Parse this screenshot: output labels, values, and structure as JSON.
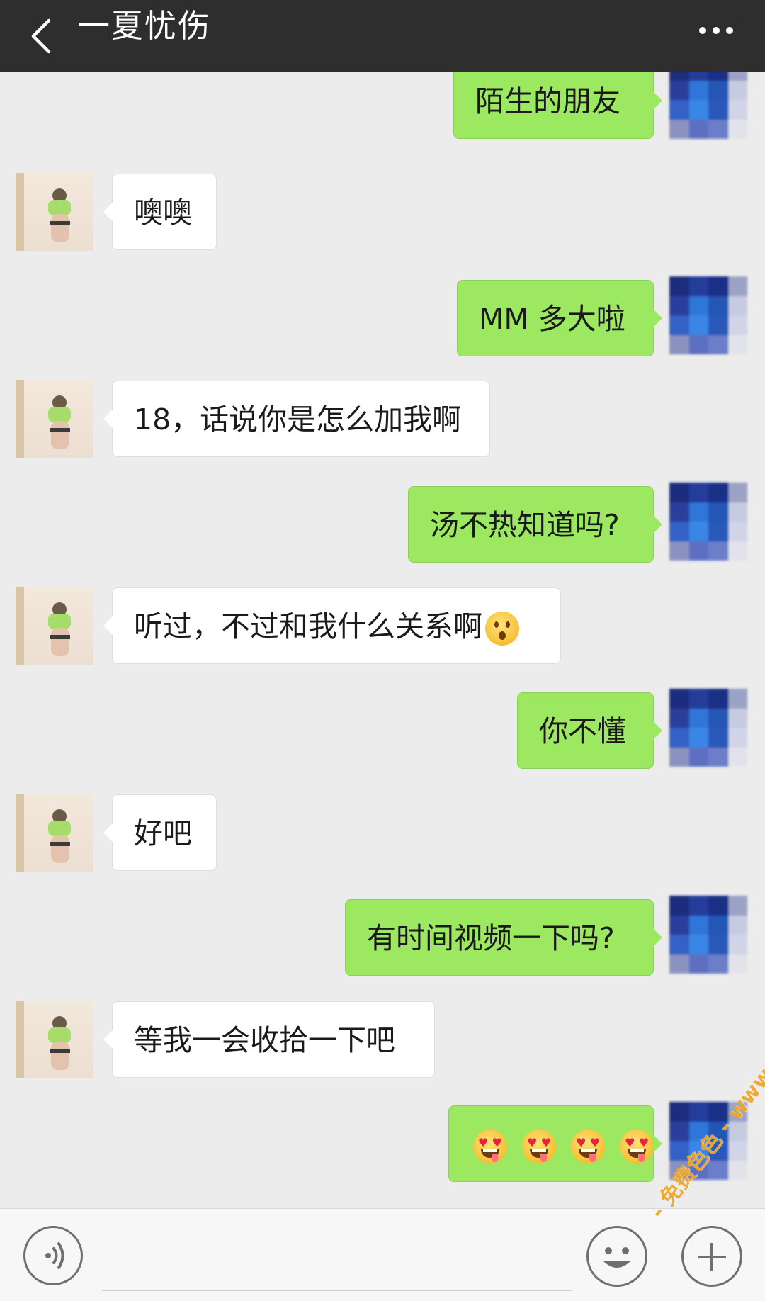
{
  "header": {
    "title": "一夏忧伤",
    "back_icon": "chevron-left-icon",
    "more_icon": "more-dots-icon",
    "background": "#2e2e2e"
  },
  "messages": [
    {
      "side": "right",
      "text": "陌生的朋友"
    },
    {
      "side": "left",
      "text": "噢噢"
    },
    {
      "side": "right",
      "text": "MM 多大啦"
    },
    {
      "side": "left",
      "text": "18，话说你是怎么加我啊"
    },
    {
      "side": "right",
      "text": "汤不热知道吗?"
    },
    {
      "side": "left",
      "text": "听过，不过和我什么关系啊",
      "emoji": "hushed-face-emoji"
    },
    {
      "side": "right",
      "text": "你不懂"
    },
    {
      "side": "left",
      "text": "好吧"
    },
    {
      "side": "right",
      "text": "有时间视频一下吗?"
    },
    {
      "side": "left",
      "text": "等我一会收拾一下吧"
    },
    {
      "side": "right",
      "text": "",
      "emoji": "heart-eyes-drooling-emoji",
      "emoji_count": 4
    }
  ],
  "input_bar": {
    "voice_icon": "voice-icon",
    "emoji_icon": "smiley-icon",
    "plus_icon": "plus-icon",
    "input_value": ""
  },
  "watermark": "- 免费色色 - www.MFsese.com",
  "colors": {
    "chat_background": "#ececec",
    "sent_bubble": "#9de861",
    "received_bubble": "#ffffff"
  }
}
